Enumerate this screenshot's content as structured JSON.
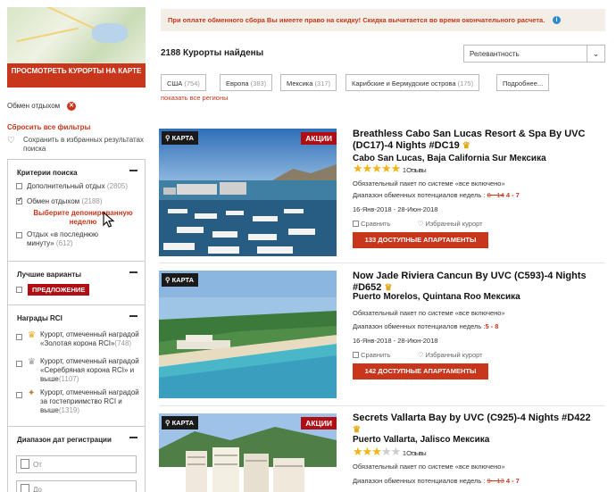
{
  "sidebar": {
    "map_button": "ПРОСМОТРЕТЬ КУРОРТЫ НА КАРТЕ",
    "active_filter": "Обмен отдыхом",
    "reset_filters": "Сбросить все фильтры",
    "save_favorites": "Сохранить в избранных результатах поиска",
    "criteria": {
      "title": "Критерии поиска",
      "options": [
        {
          "label": "Дополнительный отдых",
          "count": "(2805)",
          "checked": false
        },
        {
          "label": "Обмен отдыхом",
          "count": "(2188)",
          "checked": true
        },
        {
          "label": "Отдых «в последнюю минуту»",
          "count": "(612)",
          "checked": false
        }
      ],
      "deposit_hint": "Выберите депонированную неделю"
    },
    "best": {
      "title": "Лучшие варианты",
      "offer": "ПРЕДЛОЖЕНИЕ"
    },
    "awards": {
      "title": "Награды RCI",
      "items": [
        {
          "label": "Курорт, отмеченный наградой «Золотая корона RCI»",
          "count": "(748)"
        },
        {
          "label": "Курорт, отмеченный наградой «Серебряная корона RCI» и выше",
          "count": "(1107)"
        },
        {
          "label": "Курорт, отмеченный наградой за гостеприимство RCI и выше",
          "count": "(1319)"
        }
      ]
    },
    "dates": {
      "title": "Диапазон дат регистрации",
      "from_placeholder": "От",
      "to_placeholder": "До"
    }
  },
  "main": {
    "banner": "При оплате обменного сбора Вы имеете право на скидку! Скидка вычитается во время окончательного расчета.",
    "results_count": "2188 Курорты найдены",
    "sort": "Релевантность",
    "regions": [
      {
        "name": "США",
        "count": "(754)"
      },
      {
        "name": "Европа",
        "count": "(383)"
      },
      {
        "name": "Мексика",
        "count": "(317)"
      },
      {
        "name": "Карибские и Бермудские острова",
        "count": "(175)"
      },
      {
        "name": "Подробнее...",
        "count": ""
      }
    ],
    "all_regions": "показать все регионы",
    "map_tag": "КАРТА",
    "promo_tag": "АКЦИИ",
    "compare": "Сравнить",
    "favorite": "Избранный курорт",
    "resorts": [
      {
        "title": "Breathless Cabo San Lucas Resort & Spa By UVC (DC17)-4 Nights #DC19",
        "location": "Cabo San Lucas,  Baja California Sur  Мексика",
        "rating": 5,
        "reviews": "1 Отзывы",
        "package": "Обязательный пакет по системе «все включено»",
        "range_label": "Диапазон обменных потенциалов недель :",
        "range_old": "8 - 14",
        "range_new": "4 - 7",
        "dates": "16-Янв-2018 - 28-Июн-2018",
        "button": "133 ДОСТУПНЫЕ АПАРТАМЕНТЫ",
        "promo": true
      },
      {
        "title": "Now Jade Riviera Cancun By UVC (C593)-4 Nights #D652",
        "location": "Puerto Morelos,  Quintana Roo  Мексика",
        "rating": 0,
        "reviews": "",
        "package": "Обязательный пакет по системе «все включено»",
        "range_label": "Диапазон обменных потенциалов недель :",
        "range_old": "",
        "range_new": "5 - 8",
        "dates": "16-Янв-2018 - 28-Июн-2018",
        "button": "142 ДОСТУПНЫЕ АПАРТАМЕНТЫ",
        "promo": false
      },
      {
        "title": "Secrets Vallarta Bay by UVC (C925)-4 Nights #D422",
        "location": "Puerto Vallarta,  Jalisco  Мексика",
        "rating": 3,
        "reviews": "1 Отзывы",
        "package": "Обязательный пакет по системе «все включено»",
        "range_label": "Диапазон обменных потенциалов недель :",
        "range_old": "9 - 13",
        "range_new": "4 - 7",
        "dates": "",
        "button": "",
        "promo": true
      }
    ]
  },
  "colors": {
    "accent": "#c8361b",
    "promo": "#b00d14",
    "star": "#f0b417",
    "banner_bg": "#f3efe6"
  }
}
